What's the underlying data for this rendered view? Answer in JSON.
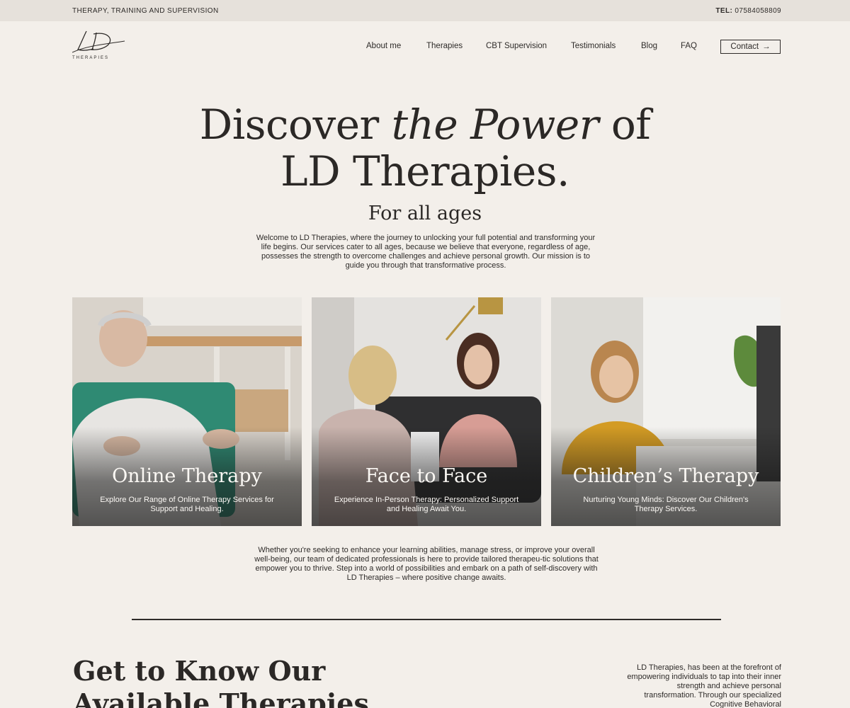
{
  "topbar": {
    "tagline": "THERAPY,  TRAINING AND SUPERVISION",
    "phone_label": "TEL:",
    "phone_number": "07584058809"
  },
  "logo": {
    "mark": "LD",
    "subtitle": "THERAPIES"
  },
  "nav": {
    "items": [
      "About me",
      "Therapies",
      "CBT Supervision",
      "Testimonials",
      "Blog",
      "FAQ"
    ],
    "contact_label": "Contact",
    "contact_icon": "arrow-right-icon"
  },
  "hero": {
    "title_part1": "Discover",
    "title_italic": "the Power",
    "title_part2": "of",
    "title_line2": "LD Therapies.",
    "subtitle": "For all ages",
    "paragraph": "Welcome to LD Therapies, where the journey to unlocking your full potential and transforming your life begins. Our services cater to all ages, because we believe that everyone, regardless of age, possesses the strength to overcome challenges and achieve personal growth. Our mission is to guide you through that transformative process."
  },
  "cards": [
    {
      "title": "Online Therapy",
      "description": "Explore Our Range of Online Therapy Services for Support and Healing."
    },
    {
      "title": "Face to Face",
      "description": "Experience In-Person Therapy: Personalized Support and Healing Await You."
    },
    {
      "title": "Children’s Therapy",
      "description": "Nurturing Young Minds: Discover Our Children's Therapy Services."
    }
  ],
  "mid": {
    "paragraph": "Whether you're seeking to enhance your learning abilities, manage stress, or improve your overall well-being, our team of dedicated professionals is here to provide tailored therapeu-tic solutions that empower you to thrive. Step into a world of possibilities and embark on a path of self-discovery with LD Therapies – where positive change awaits."
  },
  "section": {
    "title": "Get to Know Our Available Therapies",
    "paragraph": "LD Therapies, has been at the forefront of empowering individuals to tap into their inner strength and achieve personal transformation. Through our specialized Cognitive Behavioral"
  },
  "colors": {
    "background": "#f3efea",
    "topbar": "#e6e1db",
    "text": "#2e2b29"
  }
}
